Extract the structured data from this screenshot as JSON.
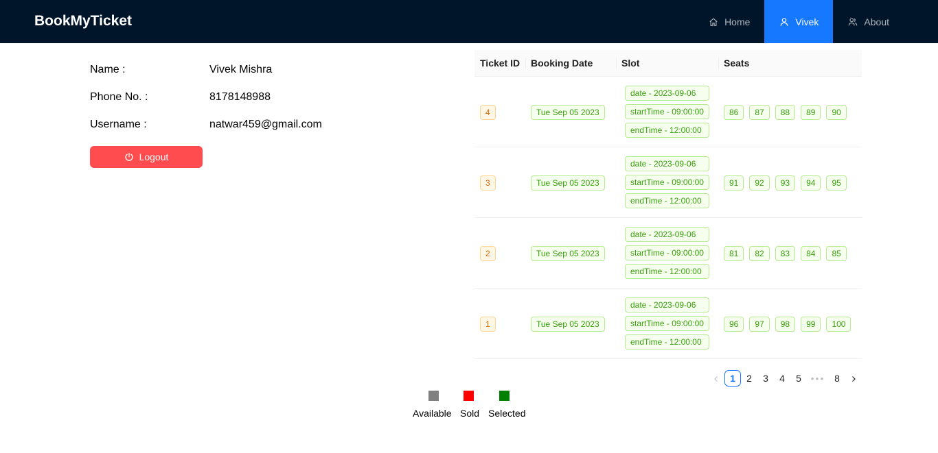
{
  "header": {
    "brand": "BookMyTicket",
    "nav": [
      {
        "label": "Home",
        "icon": "home-icon"
      },
      {
        "label": "Vivek",
        "icon": "user-icon",
        "active": true
      },
      {
        "label": "About",
        "icon": "team-icon"
      }
    ]
  },
  "profile": {
    "name_label": "Name :",
    "name_value": "Vivek Mishra",
    "phone_label": "Phone No. :",
    "phone_value": "8178148988",
    "username_label": "Username :",
    "username_value": "natwar459@gmail.com",
    "logout_label": "Logout",
    "logout_color": "#ff4d4f"
  },
  "table": {
    "columns": [
      "Ticket ID",
      "Booking Date",
      "Slot",
      "Seats"
    ],
    "rows": [
      {
        "id": "4",
        "booking_date": "Tue Sep 05 2023",
        "slot": [
          "date - 2023-09-06",
          "startTime - 09:00:00",
          "endTime - 12:00:00"
        ],
        "seats": [
          "86",
          "87",
          "88",
          "89",
          "90"
        ]
      },
      {
        "id": "3",
        "booking_date": "Tue Sep 05 2023",
        "slot": [
          "date - 2023-09-06",
          "startTime - 09:00:00",
          "endTime - 12:00:00"
        ],
        "seats": [
          "91",
          "92",
          "93",
          "94",
          "95"
        ]
      },
      {
        "id": "2",
        "booking_date": "Tue Sep 05 2023",
        "slot": [
          "date - 2023-09-06",
          "startTime - 09:00:00",
          "endTime - 12:00:00"
        ],
        "seats": [
          "81",
          "82",
          "83",
          "84",
          "85"
        ]
      },
      {
        "id": "1",
        "booking_date": "Tue Sep 05 2023",
        "slot": [
          "date - 2023-09-06",
          "startTime - 09:00:00",
          "endTime - 12:00:00"
        ],
        "seats": [
          "96",
          "97",
          "98",
          "99",
          "100"
        ]
      }
    ]
  },
  "pagination": {
    "pages": [
      "1",
      "2",
      "3",
      "4",
      "5"
    ],
    "ellipsis": "•••",
    "last": "8",
    "current": "1"
  },
  "legend": [
    {
      "label": "Available",
      "color": "#808080"
    },
    {
      "label": "Sold",
      "color": "#ff0000"
    },
    {
      "label": "Selected",
      "color": "#008000"
    }
  ]
}
